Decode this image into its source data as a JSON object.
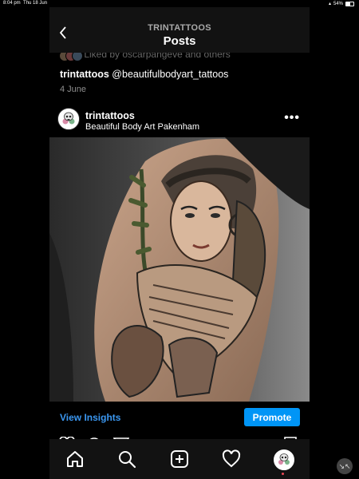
{
  "status_bar": {
    "time": "8:04 pm",
    "date": "Thu 18 Jun",
    "battery": "54%",
    "battery_level": 0.54
  },
  "header": {
    "username": "TRINTATTOOS",
    "title": "Posts"
  },
  "previous_post": {
    "liked_text": "Liked by oscarpangeve and others",
    "caption_user": "trintattoos",
    "caption_text": "@beautifulbodyart_tattoos",
    "date": "4 June"
  },
  "post": {
    "username": "trintattoos",
    "location": "Beautiful Body Art Pakenham",
    "more": "•••",
    "image_subject": "tattoo-photo"
  },
  "insights_bar": {
    "view_insights": "View Insights",
    "promote": "Promote"
  },
  "icons": {
    "back": "chevron-left-icon",
    "like": "heart-icon",
    "comment": "comment-icon",
    "share": "send-icon",
    "save": "bookmark-icon"
  },
  "tabs": [
    {
      "name": "home",
      "icon": "home-icon"
    },
    {
      "name": "search",
      "icon": "search-icon"
    },
    {
      "name": "new-post",
      "icon": "plus-square-icon"
    },
    {
      "name": "activity",
      "icon": "heart-icon"
    },
    {
      "name": "profile",
      "icon": "avatar"
    }
  ],
  "colors": {
    "link_blue": "#3b97f0",
    "promote_blue": "#0095f6",
    "bar_bg": "#121212"
  }
}
